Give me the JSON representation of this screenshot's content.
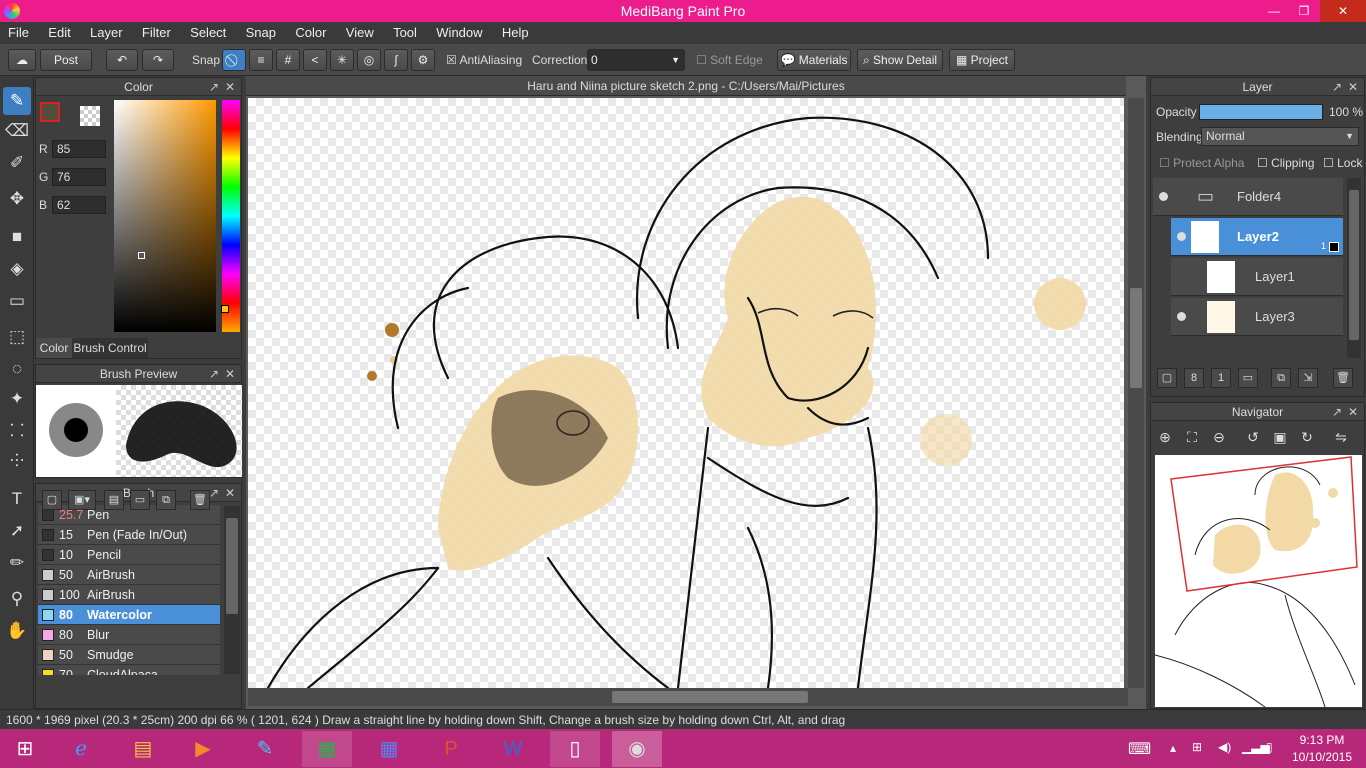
{
  "window": {
    "title": "MediBang Paint Pro",
    "min": "—",
    "max": "❐",
    "close": "✕"
  },
  "menu": [
    "File",
    "Edit",
    "Layer",
    "Filter",
    "Select",
    "Snap",
    "Color",
    "View",
    "Tool",
    "Window",
    "Help"
  ],
  "toolbar": {
    "post": "Post",
    "snap": "Snap",
    "antialiasing": "AntiAliasing",
    "correction": "Correction",
    "correction_value": "0",
    "soft_edge": "Soft Edge",
    "materials": "Materials",
    "show_detail": "Show Detail",
    "project": "Project"
  },
  "color_panel": {
    "title": "Color",
    "r_label": "R",
    "r": "85",
    "g_label": "G",
    "g": "76",
    "b_label": "B",
    "b": "62",
    "tab_color": "Color",
    "tab_brush_control": "Brush Control",
    "current_color": "#554c3e"
  },
  "brush_preview": {
    "title": "Brush Preview"
  },
  "brush_panel": {
    "title": "Brush",
    "items": [
      {
        "size": "25.7",
        "name": "Pen",
        "swatch": "#333333",
        "size_color": "#f08080"
      },
      {
        "size": "15",
        "name": "Pen (Fade In/Out)",
        "swatch": "#333333"
      },
      {
        "size": "10",
        "name": "Pencil",
        "swatch": "#333333"
      },
      {
        "size": "50",
        "name": "AirBrush",
        "swatch": "#cccccc"
      },
      {
        "size": "100",
        "name": "AirBrush",
        "swatch": "#cccccc"
      },
      {
        "size": "80",
        "name": "Watercolor",
        "swatch": "#8fd8f5",
        "selected": true
      },
      {
        "size": "80",
        "name": "Blur",
        "swatch": "#f5a8e8"
      },
      {
        "size": "50",
        "name": "Smudge",
        "swatch": "#f5d0c0"
      },
      {
        "size": "70",
        "name": "CloudAlpaca",
        "swatch": "#f0e020"
      }
    ]
  },
  "document": {
    "tab": "Haru and Niina picture sketch 2.png - C:/Users/Mai/Pictures"
  },
  "layer_panel": {
    "title": "Layer",
    "opacity_label": "Opacity",
    "opacity_value": "100 %",
    "opacity": 1.0,
    "blending_label": "Blending",
    "blending": "Normal",
    "protect_alpha": "Protect Alpha",
    "clipping": "Clipping",
    "lock": "Lock",
    "layers": [
      {
        "name": "Folder4",
        "type": "folder"
      },
      {
        "name": "Layer2",
        "selected": true,
        "badge": "1"
      },
      {
        "name": "Layer1"
      },
      {
        "name": "Layer3"
      }
    ]
  },
  "navigator": {
    "title": "Navigator"
  },
  "status": {
    "text": "1600 * 1969 pixel   (20.3 * 25cm)   200 dpi   66 %   ( 1201, 624 )   Draw a straight line by holding down Shift, Change a brush size by holding down Ctrl, Alt, and drag"
  },
  "taskbar": {
    "time": "9:13 PM",
    "date": "10/10/2015"
  }
}
